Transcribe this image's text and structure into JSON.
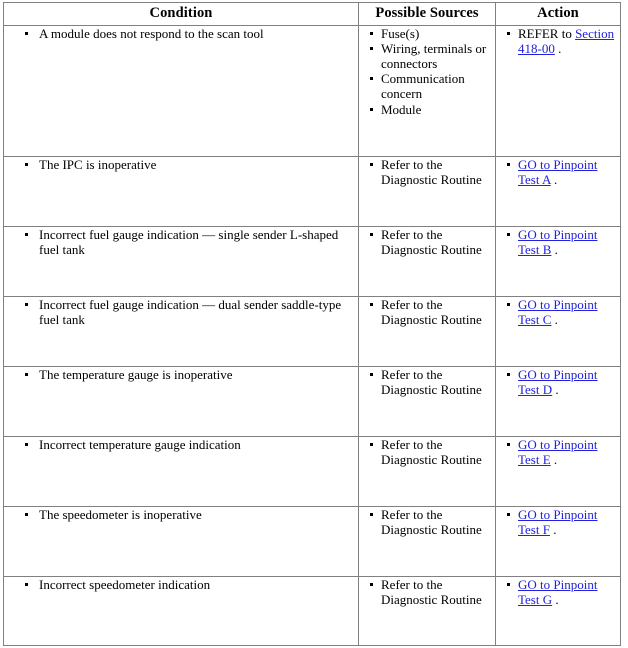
{
  "table": {
    "headers": [
      "Condition",
      "Possible Sources",
      "Action"
    ],
    "rows": [
      {
        "condition": [
          "A module does not respond to the scan tool"
        ],
        "sources": [
          "Fuse(s)",
          "Wiring, terminals or connectors",
          "Communication concern",
          "Module"
        ],
        "action_prefix": "REFER to ",
        "action_link": "Section 418-00",
        "action_suffix": " ."
      },
      {
        "condition": [
          "The IPC is inoperative"
        ],
        "sources": [
          "Refer to the Diagnostic Routine"
        ],
        "action_prefix": "",
        "action_link": "GO to Pinpoint Test A",
        "action_suffix": " ."
      },
      {
        "condition": [
          "Incorrect fuel gauge indication — single sender L-shaped fuel tank"
        ],
        "sources": [
          "Refer to the Diagnostic Routine"
        ],
        "action_prefix": "",
        "action_link": "GO to Pinpoint Test B",
        "action_suffix": " ."
      },
      {
        "condition": [
          "Incorrect fuel gauge indication — dual sender saddle-type fuel tank"
        ],
        "sources": [
          "Refer to the Diagnostic Routine"
        ],
        "action_prefix": "",
        "action_link": "GO to Pinpoint Test C",
        "action_suffix": " ."
      },
      {
        "condition": [
          "The temperature gauge is inoperative"
        ],
        "sources": [
          "Refer to the Diagnostic Routine"
        ],
        "action_prefix": "",
        "action_link": "GO to Pinpoint Test D",
        "action_suffix": " ."
      },
      {
        "condition": [
          "Incorrect temperature gauge indication"
        ],
        "sources": [
          "Refer to the Diagnostic Routine"
        ],
        "action_prefix": "",
        "action_link": "GO to Pinpoint Test E",
        "action_suffix": " ."
      },
      {
        "condition": [
          "The speedometer is inoperative"
        ],
        "sources": [
          "Refer to the Diagnostic Routine"
        ],
        "action_prefix": "",
        "action_link": "GO to Pinpoint Test F",
        "action_suffix": " ."
      },
      {
        "condition": [
          "Incorrect speedometer indication"
        ],
        "sources": [
          "Refer to the Diagnostic Routine"
        ],
        "action_prefix": "",
        "action_link": "GO to Pinpoint Test G",
        "action_suffix": " ."
      }
    ]
  },
  "colors": {
    "link": "#2222dd",
    "border": "#808080",
    "text": "#000000",
    "background": "#ffffff"
  }
}
